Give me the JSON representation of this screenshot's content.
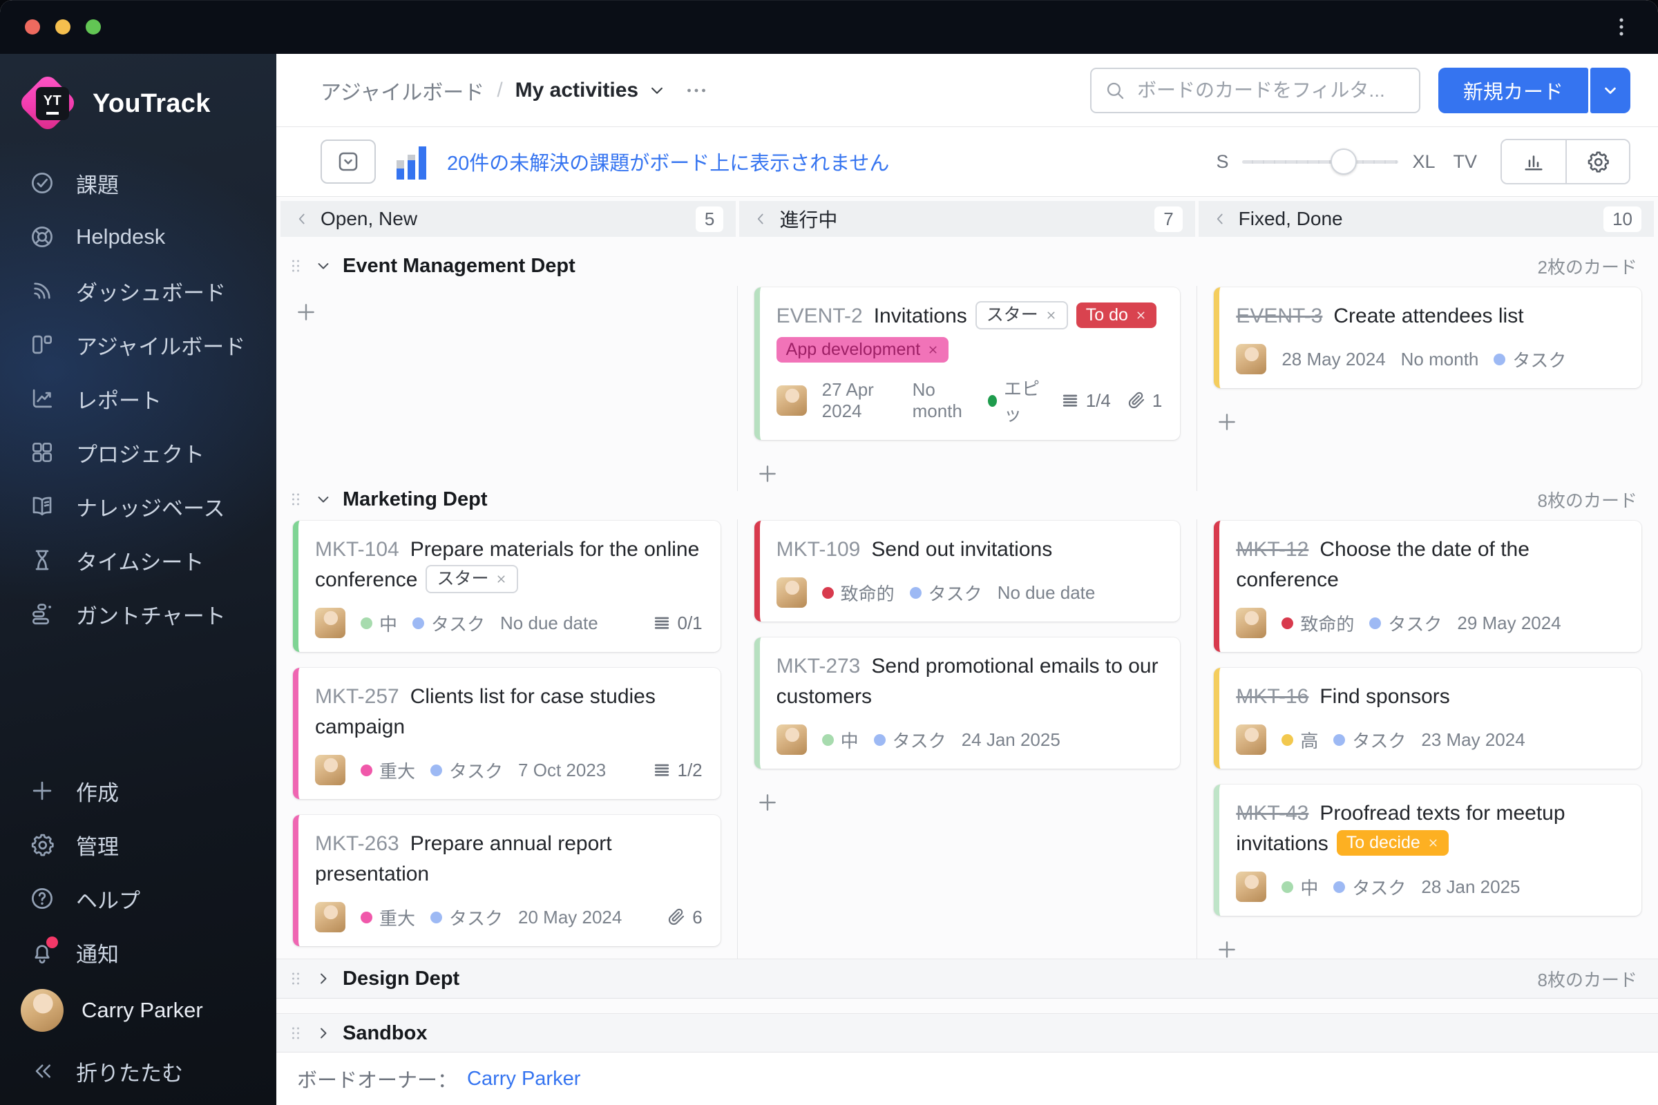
{
  "theme": {
    "accent": "#3574f0",
    "titlebar_bg": "#0a0e16",
    "traffic_lights": {
      "close": "#ee6a5f",
      "minimize": "#f5bf4e",
      "zoom": "#62c554"
    }
  },
  "titlebar": {
    "menu_icon": "kebab-vertical-icon"
  },
  "sidebar": {
    "logo": {
      "badge": "YT",
      "text": "YouTrack"
    },
    "nav": [
      {
        "id": "issues",
        "icon": "check-circle-icon",
        "label": "課題"
      },
      {
        "id": "helpdesk",
        "icon": "lifebuoy-icon",
        "label": "Helpdesk"
      },
      {
        "id": "dashboards",
        "icon": "dashboard-icon",
        "label": "ダッシュボード"
      },
      {
        "id": "agile-boards",
        "icon": "agile-board-icon",
        "label": "アジャイルボード"
      },
      {
        "id": "reports",
        "icon": "report-icon",
        "label": "レポート"
      },
      {
        "id": "projects",
        "icon": "projects-icon",
        "label": "プロジェクト"
      },
      {
        "id": "knowledge-base",
        "icon": "book-icon",
        "label": "ナレッジベース"
      },
      {
        "id": "timesheets",
        "icon": "hourglass-icon",
        "label": "タイムシート"
      },
      {
        "id": "gantt-charts",
        "icon": "gantt-icon",
        "label": "ガントチャート"
      }
    ],
    "actions": [
      {
        "id": "create",
        "icon": "plus-icon",
        "label": "作成"
      },
      {
        "id": "administration",
        "icon": "gear-icon",
        "label": "管理"
      },
      {
        "id": "help",
        "icon": "help-icon",
        "label": "ヘルプ"
      },
      {
        "id": "notifications",
        "icon": "bell-icon",
        "label": "通知",
        "badge": true
      }
    ],
    "user": {
      "name": "Carry Parker"
    },
    "collapse": {
      "icon": "collapse-icon",
      "label": "折りたたむ"
    }
  },
  "header": {
    "breadcrumb": {
      "parent": "アジャイルボード",
      "separator": "/",
      "current": "My activities"
    },
    "search": {
      "placeholder": "ボードのカードをフィルタ...",
      "value": ""
    },
    "new_card": {
      "label": "新規カード"
    }
  },
  "toolbar": {
    "unresolved_message": "20件の未解決の課題がボード上に表示されません",
    "zoom": {
      "min": "S",
      "max": "XL",
      "tv": "TV",
      "value_percent": 65
    }
  },
  "board": {
    "columns": [
      {
        "title": "Open, New",
        "count": "5"
      },
      {
        "title": "進行中",
        "count": "7"
      },
      {
        "title": "Fixed, Done",
        "count": "10"
      }
    ],
    "swimlanes": [
      {
        "title": "Event Management Dept",
        "count": "2枚のカード",
        "state": "expanded",
        "body_height": 280,
        "cols": [
          {
            "cards": [],
            "add": true
          },
          {
            "cards": [
              {
                "id": "EVENT-2",
                "resolved": false,
                "accent": "#b7e0c0",
                "title": "Invitations",
                "inline_badges": [
                  {
                    "text": "スター",
                    "type": "tag"
                  },
                  {
                    "text": "To do",
                    "type": "chip",
                    "bg": "#d9434f",
                    "fg": "#ffffff"
                  }
                ],
                "row_badges": [
                  {
                    "text": "App development",
                    "type": "chip",
                    "bg": "#f173b8",
                    "fg": "#9e2066"
                  }
                ],
                "meta": [
                  {
                    "t": "avatar"
                  },
                  {
                    "t": "text",
                    "v": "27 Apr 2024"
                  },
                  {
                    "t": "text",
                    "v": "No month"
                  },
                  {
                    "t": "dot",
                    "c": "#1f9c4d",
                    "v": "エピッ"
                  },
                  {
                    "t": "check",
                    "v": "1/4",
                    "right": true
                  },
                  {
                    "t": "attach",
                    "v": "1"
                  }
                ]
              }
            ],
            "add": true
          },
          {
            "cards": [
              {
                "id": "EVENT-3",
                "resolved": true,
                "accent": "#f4cd5d",
                "title": "Create attendees list",
                "inline_badges": [],
                "row_badges": [],
                "meta": [
                  {
                    "t": "avatar"
                  },
                  {
                    "t": "text",
                    "v": "28 May 2024"
                  },
                  {
                    "t": "text",
                    "v": "No month"
                  },
                  {
                    "t": "dot",
                    "c": "#9db9f4",
                    "v": "タスク"
                  }
                ]
              }
            ],
            "add": true
          }
        ]
      },
      {
        "title": "Marketing Dept",
        "count": "8枚のカード",
        "state": "expanded",
        "body_height": 636,
        "cols": [
          {
            "cards": [
              {
                "id": "MKT-104",
                "resolved": false,
                "accent": "#7fd494",
                "title": "Prepare materials for the online conference",
                "inline_badges": [
                  {
                    "text": "スター",
                    "type": "tag"
                  }
                ],
                "row_badges": [],
                "meta": [
                  {
                    "t": "avatar"
                  },
                  {
                    "t": "dot",
                    "c": "#a7dbae",
                    "v": "中"
                  },
                  {
                    "t": "dot",
                    "c": "#9db9f4",
                    "v": "タスク"
                  },
                  {
                    "t": "text",
                    "v": "No due date"
                  },
                  {
                    "t": "check",
                    "v": "0/1",
                    "right": true
                  }
                ]
              },
              {
                "id": "MKT-257",
                "resolved": false,
                "accent": "#ef66b2",
                "title": "Clients list for case studies campaign",
                "inline_badges": [],
                "row_badges": [],
                "meta": [
                  {
                    "t": "avatar"
                  },
                  {
                    "t": "dot",
                    "c": "#f058aa",
                    "v": "重大"
                  },
                  {
                    "t": "dot",
                    "c": "#9db9f4",
                    "v": "タスク"
                  },
                  {
                    "t": "text",
                    "v": "7 Oct 2023"
                  },
                  {
                    "t": "check",
                    "v": "1/2",
                    "right": true
                  }
                ]
              },
              {
                "id": "MKT-263",
                "resolved": false,
                "accent": "#ef66b2",
                "title": "Prepare annual report presentation",
                "inline_badges": [],
                "row_badges": [],
                "meta": [
                  {
                    "t": "avatar"
                  },
                  {
                    "t": "dot",
                    "c": "#f058aa",
                    "v": "重大"
                  },
                  {
                    "t": "dot",
                    "c": "#9db9f4",
                    "v": "タスク"
                  },
                  {
                    "t": "text",
                    "v": "20 May 2024"
                  },
                  {
                    "t": "attach",
                    "v": "6",
                    "right": true
                  }
                ]
              }
            ],
            "add": true
          },
          {
            "cards": [
              {
                "id": "MKT-109",
                "resolved": false,
                "accent": "#d83a4d",
                "title": "Send out invitations",
                "inline_badges": [],
                "row_badges": [],
                "meta": [
                  {
                    "t": "avatar"
                  },
                  {
                    "t": "dot",
                    "c": "#d83a4d",
                    "v": "致命的"
                  },
                  {
                    "t": "dot",
                    "c": "#9db9f4",
                    "v": "タスク"
                  },
                  {
                    "t": "text",
                    "v": "No due date"
                  }
                ]
              },
              {
                "id": "MKT-273",
                "resolved": false,
                "accent": "#b7e0c0",
                "title": "Send promotional emails to our customers",
                "inline_badges": [],
                "row_badges": [],
                "meta": [
                  {
                    "t": "avatar"
                  },
                  {
                    "t": "dot",
                    "c": "#a7dbae",
                    "v": "中"
                  },
                  {
                    "t": "dot",
                    "c": "#9db9f4",
                    "v": "タスク"
                  },
                  {
                    "t": "text",
                    "v": "24 Jan 2025"
                  }
                ]
              }
            ],
            "add": true
          },
          {
            "cards": [
              {
                "id": "MKT-12",
                "resolved": true,
                "accent": "#d83a4d",
                "title": "Choose the date of the conference",
                "inline_badges": [],
                "row_badges": [],
                "meta": [
                  {
                    "t": "avatar"
                  },
                  {
                    "t": "dot",
                    "c": "#d83a4d",
                    "v": "致命的"
                  },
                  {
                    "t": "dot",
                    "c": "#9db9f4",
                    "v": "タスク"
                  },
                  {
                    "t": "text",
                    "v": "29 May 2024"
                  }
                ]
              },
              {
                "id": "MKT-16",
                "resolved": true,
                "accent": "#f4cd5d",
                "title": "Find sponsors",
                "inline_badges": [],
                "row_badges": [],
                "meta": [
                  {
                    "t": "avatar"
                  },
                  {
                    "t": "dot",
                    "c": "#f2c84e",
                    "v": "高"
                  },
                  {
                    "t": "dot",
                    "c": "#9db9f4",
                    "v": "タスク"
                  },
                  {
                    "t": "text",
                    "v": "23 May 2024"
                  }
                ]
              },
              {
                "id": "MKT-43",
                "resolved": true,
                "accent": "#bfe4c8",
                "title": "Proofread texts for meetup invitations",
                "inline_badges": [
                  {
                    "text": "To decide",
                    "type": "chip",
                    "bg": "#fdb022",
                    "fg": "#ffffff"
                  }
                ],
                "row_badges": [],
                "meta": [
                  {
                    "t": "avatar"
                  },
                  {
                    "t": "dot",
                    "c": "#a7dbae",
                    "v": "中"
                  },
                  {
                    "t": "dot",
                    "c": "#9db9f4",
                    "v": "タスク"
                  },
                  {
                    "t": "text",
                    "v": "28 Jan 2025"
                  }
                ]
              }
            ],
            "add": true
          }
        ]
      },
      {
        "title": "Design Dept",
        "count": "8枚のカード",
        "state": "collapsed"
      },
      {
        "title": "Sandbox",
        "count": "",
        "state": "collapsed",
        "gap_before": 21
      }
    ],
    "owner": {
      "label": "ボードオーナー：",
      "name": "Carry Parker"
    }
  }
}
